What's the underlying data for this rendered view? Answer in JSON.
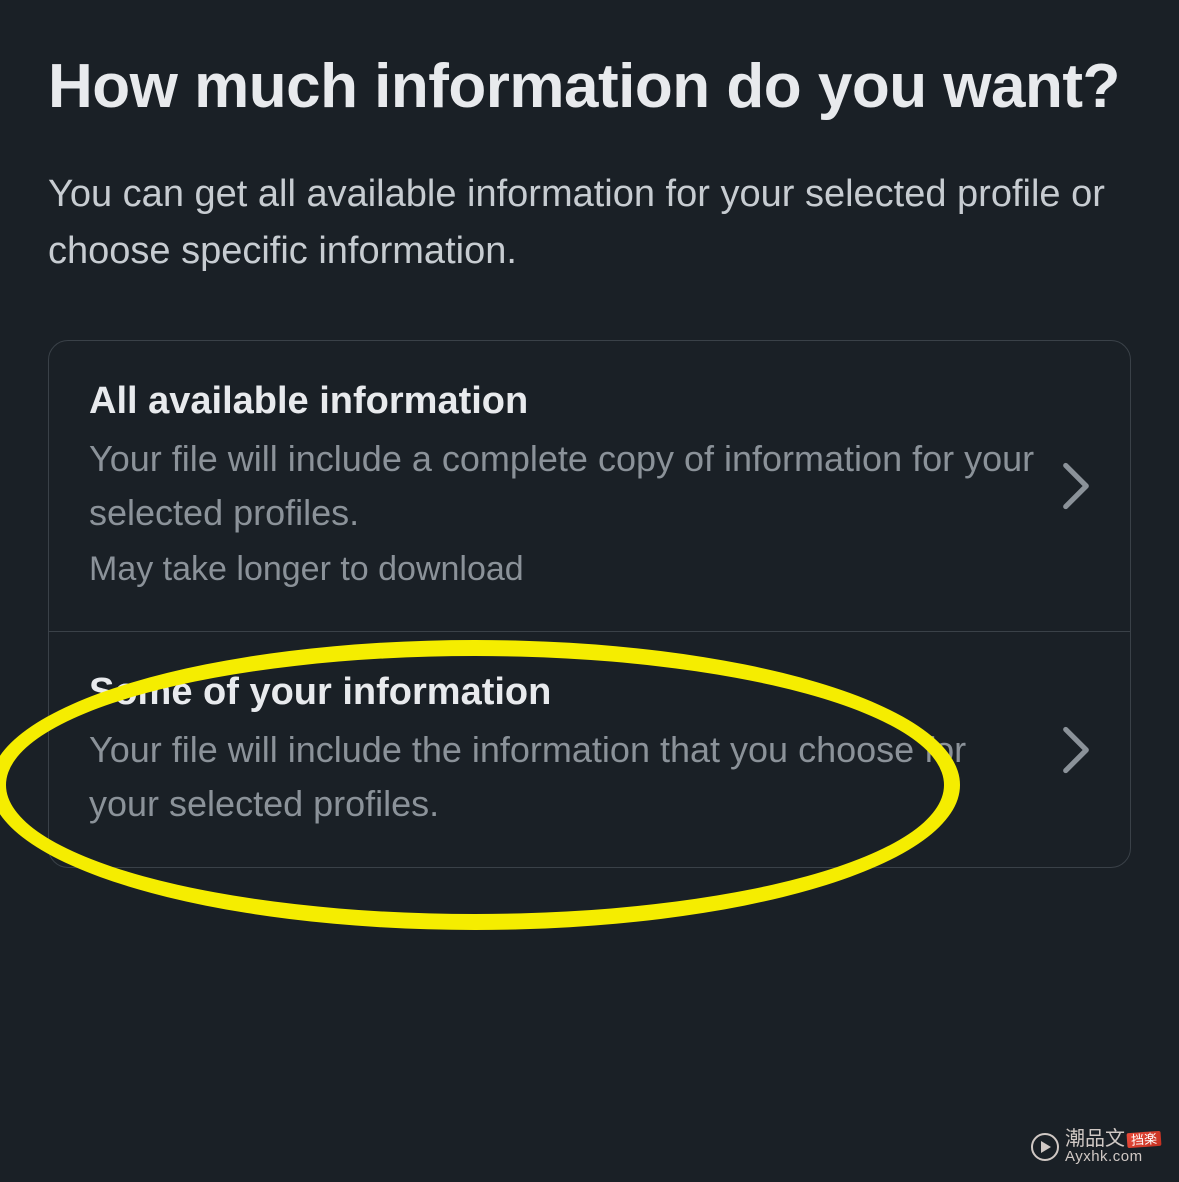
{
  "header": {
    "title": "How much information do you want?",
    "subtitle": "You can get all available information for your selected profile or choose specific information."
  },
  "options": {
    "all": {
      "title": "All available information",
      "description": "Your file will include a complete copy of information for your selected profiles.",
      "note": "May take longer to download"
    },
    "some": {
      "title": "Some of your information",
      "description": "Your file will include the information that you choose for your selected profiles."
    }
  },
  "icons": {
    "chevron_right": "chevron-right-icon"
  },
  "watermark": {
    "chinese": "潮品文",
    "badge": "挡楽",
    "url": "Ayxhk.com"
  }
}
